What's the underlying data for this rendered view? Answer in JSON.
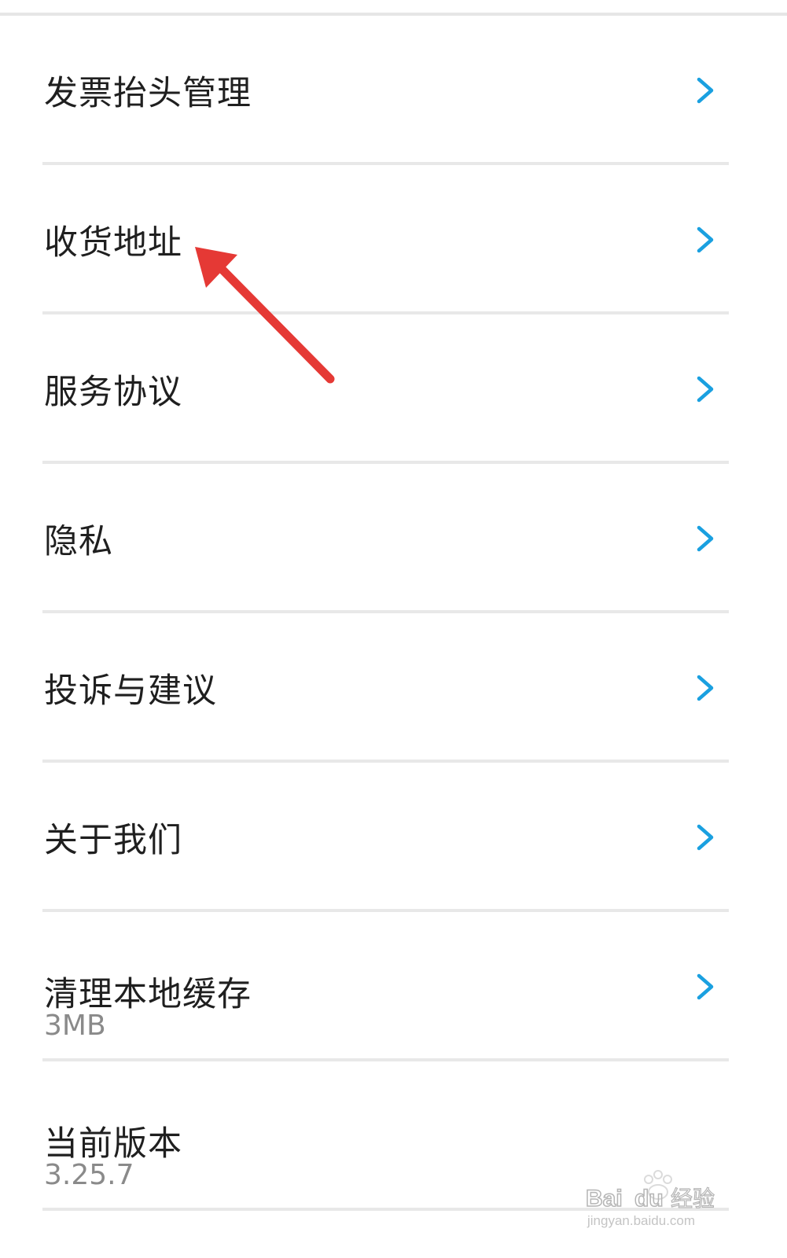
{
  "settings": {
    "items": [
      {
        "label": "发票抬头管理"
      },
      {
        "label": "收货地址"
      },
      {
        "label": "服务协议"
      },
      {
        "label": "隐私"
      },
      {
        "label": "投诉与建议"
      },
      {
        "label": "关于我们"
      },
      {
        "label": "清理本地缓存",
        "sub": "3MB"
      },
      {
        "label": "当前版本",
        "sub": "3.25.7"
      }
    ]
  },
  "watermark": {
    "brand": "Bai",
    "brand2": "du",
    "product": "经验",
    "url": "jingyan.baidu.com"
  },
  "colors": {
    "chevron": "#1aa0e0",
    "annotation_arrow": "#e53935"
  },
  "icons": {
    "chevron": "chevron-right-icon",
    "annotation": "annotation-arrow-icon"
  }
}
